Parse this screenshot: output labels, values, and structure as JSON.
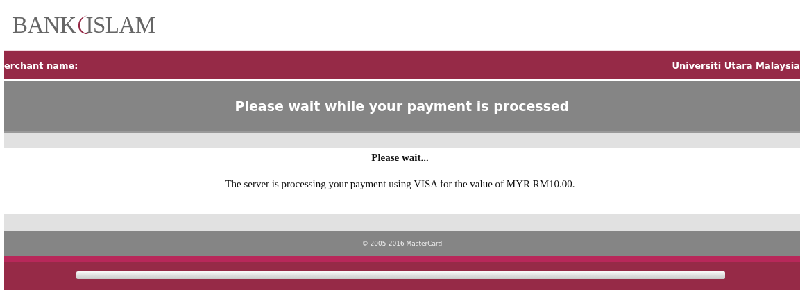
{
  "logo": {
    "left": "BANK",
    "right": "ISLAM"
  },
  "merchant_bar": {
    "label": "erchant name:",
    "value": "Universiti Utara Malaysia"
  },
  "header": {
    "title": "Please wait while your payment is processed"
  },
  "content": {
    "heading": "Please wait...",
    "message": "The server is processing your payment using VISA for the value of MYR RM10.00."
  },
  "footer": {
    "copyright": "© 2005-2016 MasterCard"
  },
  "progress": {
    "level": 1
  }
}
